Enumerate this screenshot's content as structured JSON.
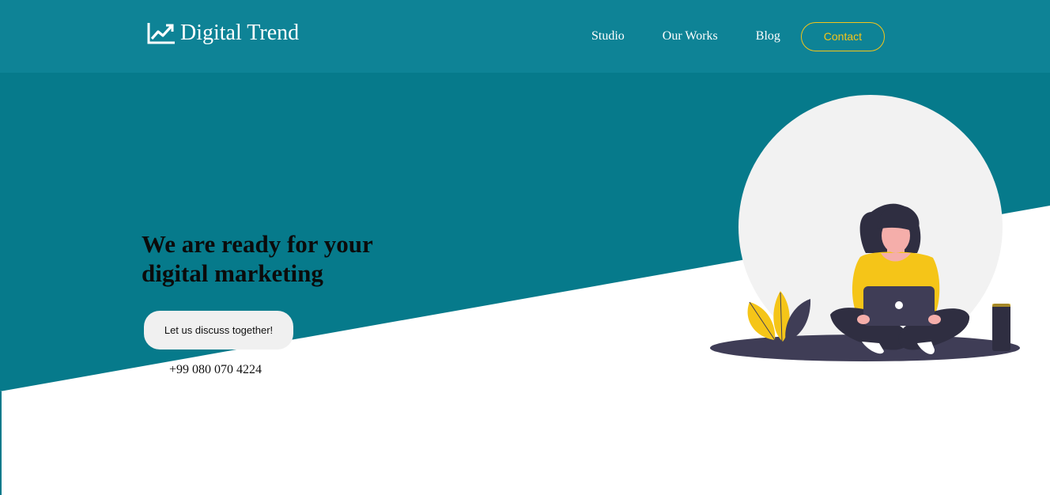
{
  "header": {
    "logo_text": "Digital Trend",
    "logo_icon": "trending-up-icon",
    "nav": {
      "studio": "Studio",
      "our_works": "Our Works",
      "blog": "Blog",
      "contact": "Contact"
    }
  },
  "hero": {
    "headline": "We are ready for your digital marketing",
    "cta_label": "Let us discuss together!",
    "phone": "+99 080 070 4224",
    "illustration": "woman-with-laptop-illustration"
  },
  "colors": {
    "header_bg": "#0e8396",
    "hero_bg": "#067a8b",
    "accent": "#f5c518",
    "body_bg": "#ffffff"
  }
}
